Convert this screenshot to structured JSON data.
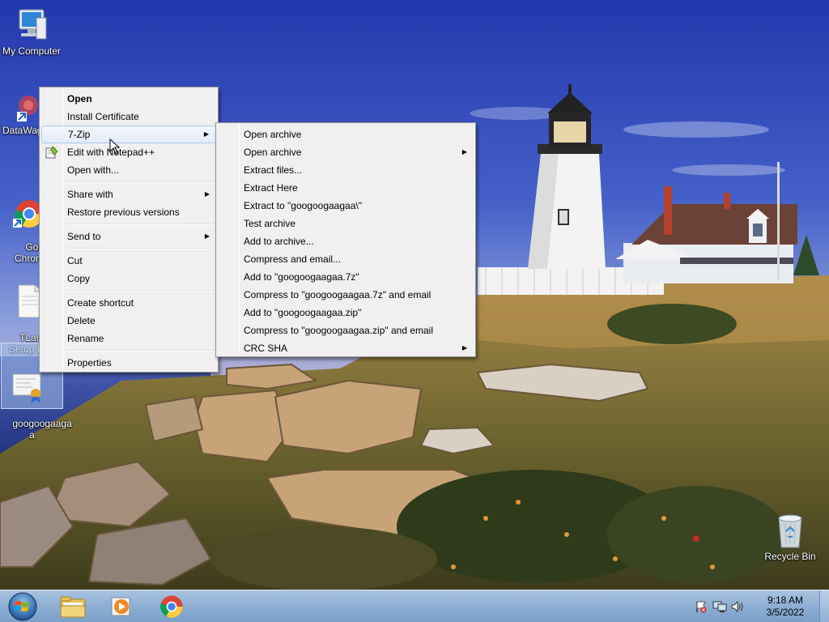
{
  "desktop": {
    "icons": [
      {
        "label": "My Computer"
      },
      {
        "label": "DataWag"
      },
      {
        "label": "Goog\nChron"
      },
      {
        "label": "TLaunc\nSetup L"
      },
      {
        "label": "googoogaaga\na"
      },
      {
        "label": "Recycle Bin"
      }
    ]
  },
  "context_menu": {
    "items": {
      "open": "Open",
      "install_certificate": "Install Certificate",
      "seven_zip": "7-Zip",
      "edit_notepad": "Edit with Notepad++",
      "open_with": "Open with...",
      "share_with": "Share with",
      "restore_previous": "Restore previous versions",
      "send_to": "Send to",
      "cut": "Cut",
      "copy": "Copy",
      "create_shortcut": "Create shortcut",
      "delete": "Delete",
      "rename": "Rename",
      "properties": "Properties"
    }
  },
  "submenu_7zip": {
    "items": [
      {
        "label": "Open archive",
        "arrow": false
      },
      {
        "label": "Open archive",
        "arrow": true
      },
      {
        "label": "Extract files...",
        "arrow": false
      },
      {
        "label": "Extract Here",
        "arrow": false
      },
      {
        "label": "Extract to \"googoogaagaa\\\"",
        "arrow": false
      },
      {
        "label": "Test archive",
        "arrow": false
      },
      {
        "label": "Add to archive...",
        "arrow": false
      },
      {
        "label": "Compress and email...",
        "arrow": false
      },
      {
        "label": "Add to \"googoogaagaa.7z\"",
        "arrow": false
      },
      {
        "label": "Compress to \"googoogaagaa.7z\" and email",
        "arrow": false
      },
      {
        "label": "Add to \"googoogaagaa.zip\"",
        "arrow": false
      },
      {
        "label": "Compress to \"googoogaagaa.zip\" and email",
        "arrow": false
      },
      {
        "label": "CRC SHA",
        "arrow": true
      }
    ]
  },
  "taskbar": {
    "clock_time": "9:18 AM",
    "clock_date": "3/5/2022"
  }
}
